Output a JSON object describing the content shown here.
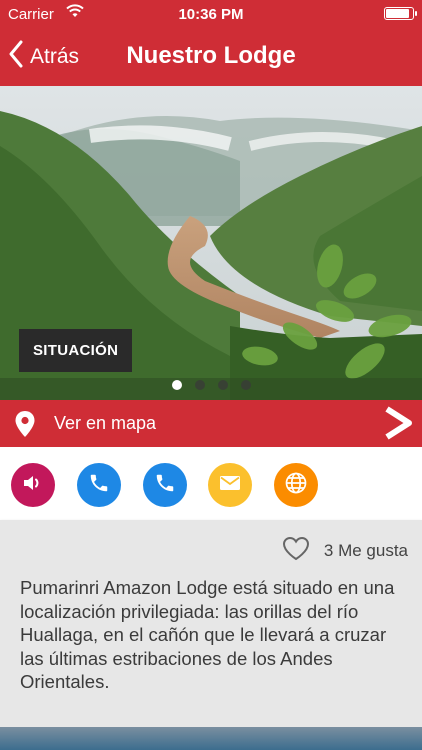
{
  "status_bar": {
    "carrier": "Carrier",
    "time": "10:36 PM",
    "battery_level": 0.95
  },
  "nav": {
    "back_label": "Atrás",
    "title": "Nuestro Lodge"
  },
  "gallery": {
    "badge": "SITUACIÓN",
    "page_count": 4,
    "current_page": 1
  },
  "map_bar": {
    "label": "Ver en mapa"
  },
  "action_buttons": [
    {
      "icon": "speaker-icon",
      "color": "#c2185b"
    },
    {
      "icon": "phone-icon",
      "color": "#1e88e5"
    },
    {
      "icon": "phone-icon",
      "color": "#1e88e5"
    },
    {
      "icon": "email-icon",
      "color": "#fbc02d"
    },
    {
      "icon": "globe-icon",
      "color": "#fb8c00"
    }
  ],
  "likes": {
    "label": "3 Me gusta"
  },
  "description": "Pumarinri Amazon Lodge está situado en una localización privilegiada: las orillas del río Huallaga, en el cañón que le llevará a cruzar las últimas estribaciones de los Andes Orientales.",
  "colors": {
    "brand_red": "#cf2d36",
    "panel_gray": "#e7e7e7"
  }
}
